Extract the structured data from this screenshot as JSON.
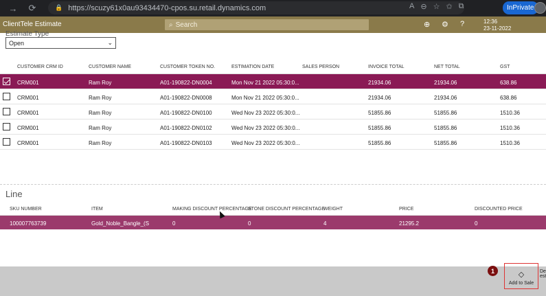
{
  "browser": {
    "url": "https://scuzy61x0au93434470-cpos.su.retail.dynamics.com",
    "inprivate_label": "InPrivate"
  },
  "header": {
    "app_title": "ClientTele Estimate",
    "search_placeholder": "Search",
    "time": "12:36",
    "date": "23-11-2022",
    "accent_color": "#8a7a4a"
  },
  "filter": {
    "label": "Estimate Type",
    "selected": "Open"
  },
  "estimates": {
    "columns": [
      "CUSTOMER CRM ID",
      "CUSTOMER NAME",
      "CUSTOMER TOKEN NO.",
      "ESTIMATION DATE",
      "SALES PERSON",
      "INVOICE TOTAL",
      "NET TOTAL",
      "GST"
    ],
    "rows": [
      {
        "crm": "CRM001",
        "name": "Ram Roy",
        "token": "A01-190822-DN0004",
        "date": "Mon Nov 21 2022 05:30:0...",
        "sales": "",
        "invoice": "21934.06",
        "net": "21934.06",
        "gst": "638.86",
        "selected": true
      },
      {
        "crm": "CRM001",
        "name": "Ram Roy",
        "token": "A01-190822-DN0008",
        "date": "Mon Nov 21 2022 05:30:0...",
        "sales": "",
        "invoice": "21934.06",
        "net": "21934.06",
        "gst": "638.86",
        "selected": false
      },
      {
        "crm": "CRM001",
        "name": "Ram Roy",
        "token": "A01-190822-DN0100",
        "date": "Wed Nov 23 2022 05:30:0...",
        "sales": "",
        "invoice": "51855.86",
        "net": "51855.86",
        "gst": "1510.36",
        "selected": false
      },
      {
        "crm": "CRM001",
        "name": "Ram Roy",
        "token": "A01-190822-DN0102",
        "date": "Wed Nov 23 2022 05:30:0...",
        "sales": "",
        "invoice": "51855.86",
        "net": "51855.86",
        "gst": "1510.36",
        "selected": false
      },
      {
        "crm": "CRM001",
        "name": "Ram Roy",
        "token": "A01-190822-DN0103",
        "date": "Wed Nov 23 2022 05:30:0...",
        "sales": "",
        "invoice": "51855.86",
        "net": "51855.86",
        "gst": "1510.36",
        "selected": false
      }
    ]
  },
  "line": {
    "title": "Line",
    "columns": [
      "SKU NUMBER",
      "ITEM",
      "MAKING DISCOUNT PERCENTAGE",
      "STONE DISCOUNT PERCENTAGE",
      "WEIGHT",
      "PRICE",
      "DISCOUNTED PRICE"
    ],
    "rows": [
      {
        "sku": "100007763739",
        "item": "Gold_Noble_Bangle_(S",
        "making": "0",
        "stone": "0",
        "weight": "4",
        "price": "21295.2",
        "discounted": "0"
      }
    ]
  },
  "appbar": {
    "badge": "1",
    "add_to_sale_label": "Add to Sale",
    "next_label": "De\nesti"
  },
  "colors": {
    "selected_row": "#8a1a55",
    "line_row": "#9b3a6c"
  }
}
